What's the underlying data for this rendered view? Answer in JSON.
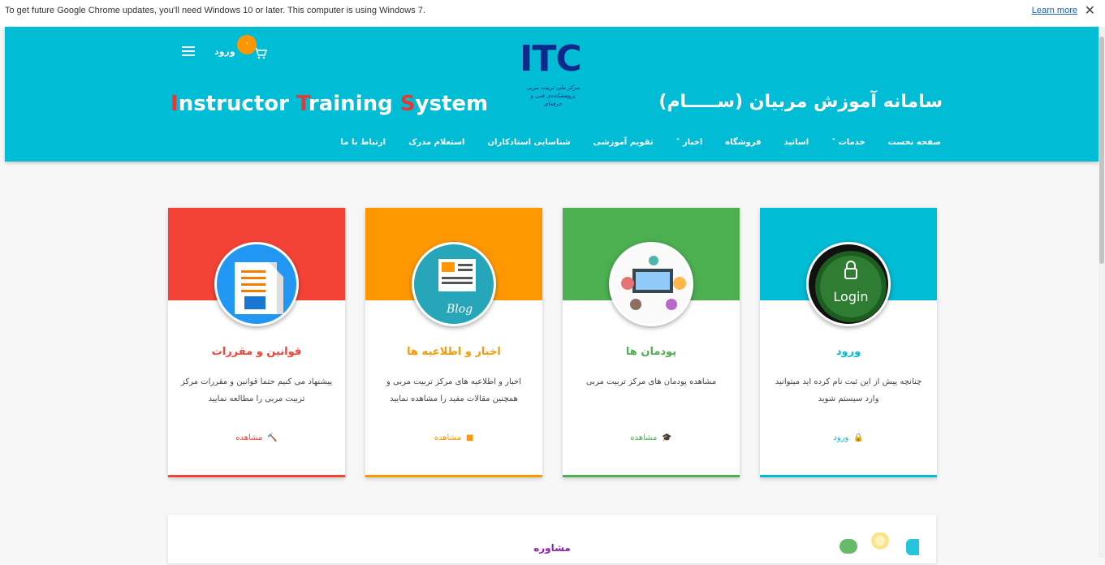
{
  "infobar": {
    "message": "To get future Google Chrome updates, you'll need Windows 10 or later. This computer is using Windows 7.",
    "learn_more": "Learn more",
    "close": "✕"
  },
  "header": {
    "login_label": "ورود",
    "cart_count": "۰",
    "logo_text": "ITC",
    "logo_subtitle": "مرکز ملی تربیت مربی\nپژوهشکده‌ی فنی و حرفه‌ای",
    "title_en": {
      "parts": [
        "I",
        "nstructor ",
        "T",
        "raining ",
        "S",
        "ystem"
      ]
    },
    "title_fa": "سامانه آموزش مربیان (ســـــام)",
    "nav": [
      {
        "label": "صفحه نخست",
        "dropdown": false
      },
      {
        "label": "خدمات",
        "dropdown": true
      },
      {
        "label": "اساتید",
        "dropdown": false
      },
      {
        "label": "فروشگاه",
        "dropdown": false
      },
      {
        "label": "اخبار",
        "dropdown": true
      },
      {
        "label": "تقویم آموزشی",
        "dropdown": false
      },
      {
        "label": "شناسایی استادکاران",
        "dropdown": false
      },
      {
        "label": "استعلام مدرک",
        "dropdown": false
      },
      {
        "label": "ارتباط با ما",
        "dropdown": false
      }
    ]
  },
  "cards": [
    {
      "title": "قوانین و مقررات",
      "desc": "پیشنهاد می کنیم حتما قوانین و مقررات مرکز تربیت مربی را مطالعه نمایید",
      "action": "مشاهده",
      "color": "#f44336",
      "icon": "gavel-icon",
      "image": "rules-document-icon"
    },
    {
      "title": "اخبار و اطلاعیه ها",
      "desc": "اخبار و اطلاعیه های مرکز تربیت مربی و همچنین مقالات مفید را مشاهده نمایید",
      "action": "مشاهده",
      "color": "#ff9800",
      "icon": "comment-icon",
      "image": "blog-icon"
    },
    {
      "title": "پودمان ها",
      "desc": "مشاهده پودمان های مرکز تربیت مربی",
      "action": "مشاهده",
      "color": "#4caf50",
      "icon": "graduation-cap-icon",
      "image": "training-icon"
    },
    {
      "title": "ورود",
      "desc": "چنانچه پیش از این ثبت نام کرده اید میتوانید وارد سیستم شوید",
      "action": "ورود",
      "color": "#00bcd4",
      "icon": "lock-icon",
      "image": "login-button-icon",
      "image_text": "Login"
    }
  ],
  "consult": {
    "label": "مشاوره"
  }
}
